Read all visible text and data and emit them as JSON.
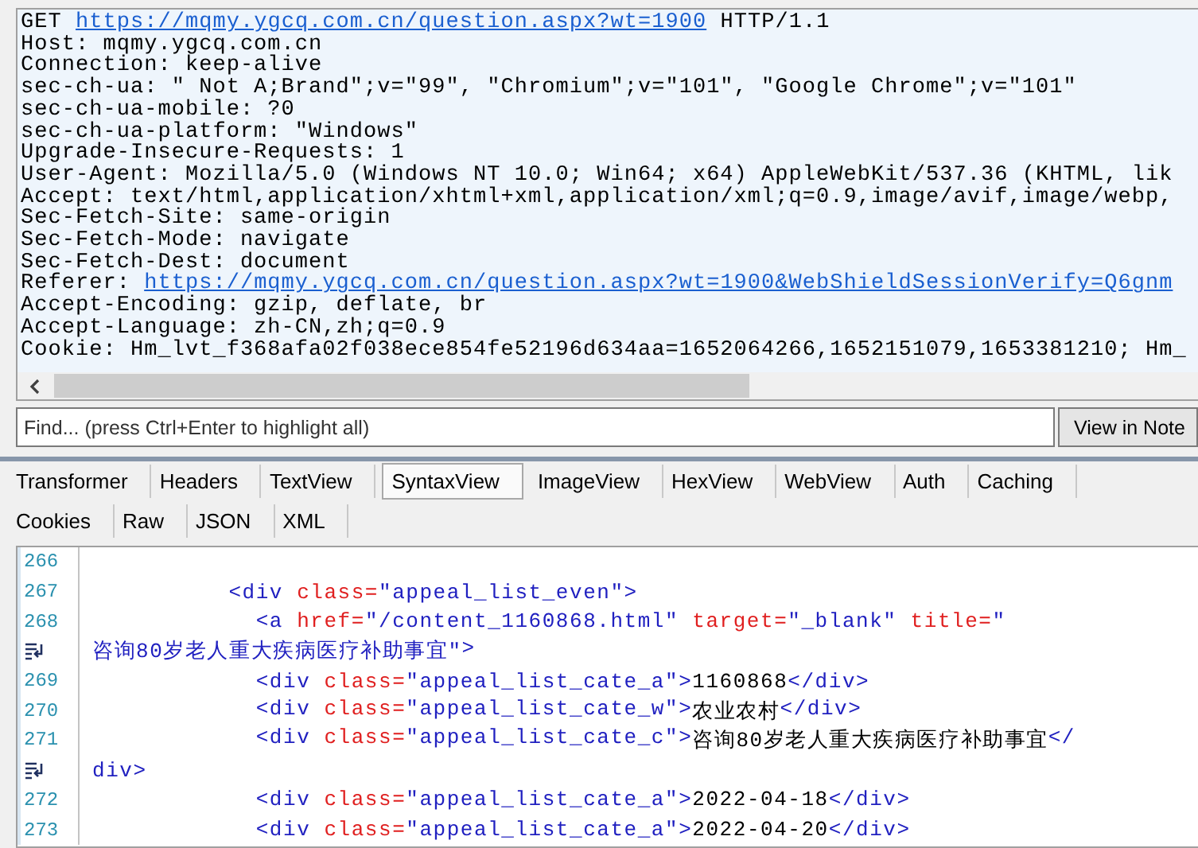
{
  "request": {
    "lines": [
      [
        {
          "kind": "text",
          "text": "GET "
        },
        {
          "kind": "link",
          "text": "https://mqmy.ygcq.com.cn/question.aspx?wt=1900"
        },
        {
          "kind": "text",
          "text": " HTTP/1.1"
        }
      ],
      [
        {
          "kind": "text",
          "text": "Host: mqmy.ygcq.com.cn"
        }
      ],
      [
        {
          "kind": "text",
          "text": "Connection: keep-alive"
        }
      ],
      [
        {
          "kind": "text",
          "text": "sec-ch-ua: \" Not A;Brand\";v=\"99\", \"Chromium\";v=\"101\", \"Google Chrome\";v=\"101\""
        }
      ],
      [
        {
          "kind": "text",
          "text": "sec-ch-ua-mobile: ?0"
        }
      ],
      [
        {
          "kind": "text",
          "text": "sec-ch-ua-platform: \"Windows\""
        }
      ],
      [
        {
          "kind": "text",
          "text": "Upgrade-Insecure-Requests: 1"
        }
      ],
      [
        {
          "kind": "text",
          "text": "User-Agent: Mozilla/5.0 (Windows NT 10.0; Win64; x64) AppleWebKit/537.36 (KHTML, lik"
        }
      ],
      [
        {
          "kind": "text",
          "text": "Accept: text/html,application/xhtml+xml,application/xml;q=0.9,image/avif,image/webp,"
        }
      ],
      [
        {
          "kind": "text",
          "text": "Sec-Fetch-Site: same-origin"
        }
      ],
      [
        {
          "kind": "text",
          "text": "Sec-Fetch-Mode: navigate"
        }
      ],
      [
        {
          "kind": "text",
          "text": "Sec-Fetch-Dest: document"
        }
      ],
      [
        {
          "kind": "text",
          "text": "Referer: "
        },
        {
          "kind": "link",
          "text": "https://mqmy.ygcq.com.cn/question.aspx?wt=1900&WebShieldSessionVerify=Q6gnm"
        }
      ],
      [
        {
          "kind": "text",
          "text": "Accept-Encoding: gzip, deflate, br"
        }
      ],
      [
        {
          "kind": "text",
          "text": "Accept-Language: zh-CN,zh;q=0.9"
        }
      ],
      [
        {
          "kind": "text",
          "text": "Cookie: Hm_lvt_f368afa02f038ece854fe52196d634aa=1652064266,1652151079,1653381210; Hm_"
        }
      ]
    ]
  },
  "find": {
    "placeholder": "Find... (press Ctrl+Enter to highlight all)",
    "button": "View in Note"
  },
  "tab_rows": [
    [
      {
        "label": "Transformer",
        "selected": false
      },
      {
        "label": "Headers",
        "selected": false
      },
      {
        "label": "TextView",
        "selected": false
      },
      {
        "label": "SyntaxView",
        "selected": true
      },
      {
        "label": "ImageView",
        "selected": false
      },
      {
        "label": "HexView",
        "selected": false
      },
      {
        "label": "WebView",
        "selected": false
      },
      {
        "label": "Auth",
        "selected": false
      },
      {
        "label": "Caching",
        "selected": false
      }
    ],
    [
      {
        "label": "Cookies",
        "selected": false
      },
      {
        "label": "Raw",
        "selected": false
      },
      {
        "label": "JSON",
        "selected": false
      },
      {
        "label": "XML",
        "selected": false
      }
    ]
  ],
  "code": {
    "lines": [
      {
        "kind": "numbered",
        "number": "266"
      },
      {
        "kind": "numbered",
        "number": "267",
        "segments": [
          {
            "kind": "tag",
            "text": "          <div"
          },
          {
            "kind": "attr",
            "text": " class="
          },
          {
            "kind": "value",
            "text": "\"appeal_list_even\""
          },
          {
            "kind": "tag",
            "text": ">"
          }
        ]
      },
      {
        "kind": "numbered",
        "number": "268",
        "segments": [
          {
            "kind": "tag",
            "text": "            <a"
          },
          {
            "kind": "attr",
            "text": " href="
          },
          {
            "kind": "value",
            "text": "\"/content_1160868.html\""
          },
          {
            "kind": "attr",
            "text": " target="
          },
          {
            "kind": "value",
            "text": "\"_blank\""
          },
          {
            "kind": "attr",
            "text": " title="
          },
          {
            "kind": "value",
            "text": "\""
          }
        ]
      },
      {
        "kind": "wrapped",
        "segments": [
          {
            "kind": "value",
            "text": "咨询80岁老人重大疾病医疗补助事宜\""
          },
          {
            "kind": "tag",
            "text": ">"
          }
        ]
      },
      {
        "kind": "numbered",
        "number": "269",
        "segments": [
          {
            "kind": "tag",
            "text": "            <div"
          },
          {
            "kind": "attr",
            "text": " class="
          },
          {
            "kind": "value",
            "text": "\"appeal_list_cate_a\""
          },
          {
            "kind": "tag",
            "text": ">"
          },
          {
            "kind": "text",
            "text": "1160868"
          },
          {
            "kind": "tag",
            "text": "</div>"
          }
        ]
      },
      {
        "kind": "numbered",
        "number": "270",
        "segments": [
          {
            "kind": "tag",
            "text": "            <div"
          },
          {
            "kind": "attr",
            "text": " class="
          },
          {
            "kind": "value",
            "text": "\"appeal_list_cate_w\""
          },
          {
            "kind": "tag",
            "text": ">"
          },
          {
            "kind": "text",
            "text": "农业农村"
          },
          {
            "kind": "tag",
            "text": "</div>"
          }
        ]
      },
      {
        "kind": "numbered",
        "number": "271",
        "segments": [
          {
            "kind": "tag",
            "text": "            <div"
          },
          {
            "kind": "attr",
            "text": " class="
          },
          {
            "kind": "value",
            "text": "\"appeal_list_cate_c\""
          },
          {
            "kind": "tag",
            "text": ">"
          },
          {
            "kind": "text",
            "text": "咨询80岁老人重大疾病医疗补助事宜"
          },
          {
            "kind": "tag",
            "text": "</"
          }
        ]
      },
      {
        "kind": "wrapped",
        "segments": [
          {
            "kind": "tag",
            "text": "div>"
          }
        ]
      },
      {
        "kind": "numbered",
        "number": "272",
        "segments": [
          {
            "kind": "tag",
            "text": "            <div"
          },
          {
            "kind": "attr",
            "text": " class="
          },
          {
            "kind": "value",
            "text": "\"appeal_list_cate_a\""
          },
          {
            "kind": "tag",
            "text": ">"
          },
          {
            "kind": "text",
            "text": "2022-04-18"
          },
          {
            "kind": "tag",
            "text": "</div>"
          }
        ]
      },
      {
        "kind": "numbered",
        "number": "273",
        "segments": [
          {
            "kind": "tag",
            "text": "            <div"
          },
          {
            "kind": "attr",
            "text": " class="
          },
          {
            "kind": "value",
            "text": "\"appeal_list_cate_a\""
          },
          {
            "kind": "tag",
            "text": ">"
          },
          {
            "kind": "text",
            "text": "2022-04-20"
          },
          {
            "kind": "tag",
            "text": "</div>"
          }
        ]
      }
    ]
  }
}
